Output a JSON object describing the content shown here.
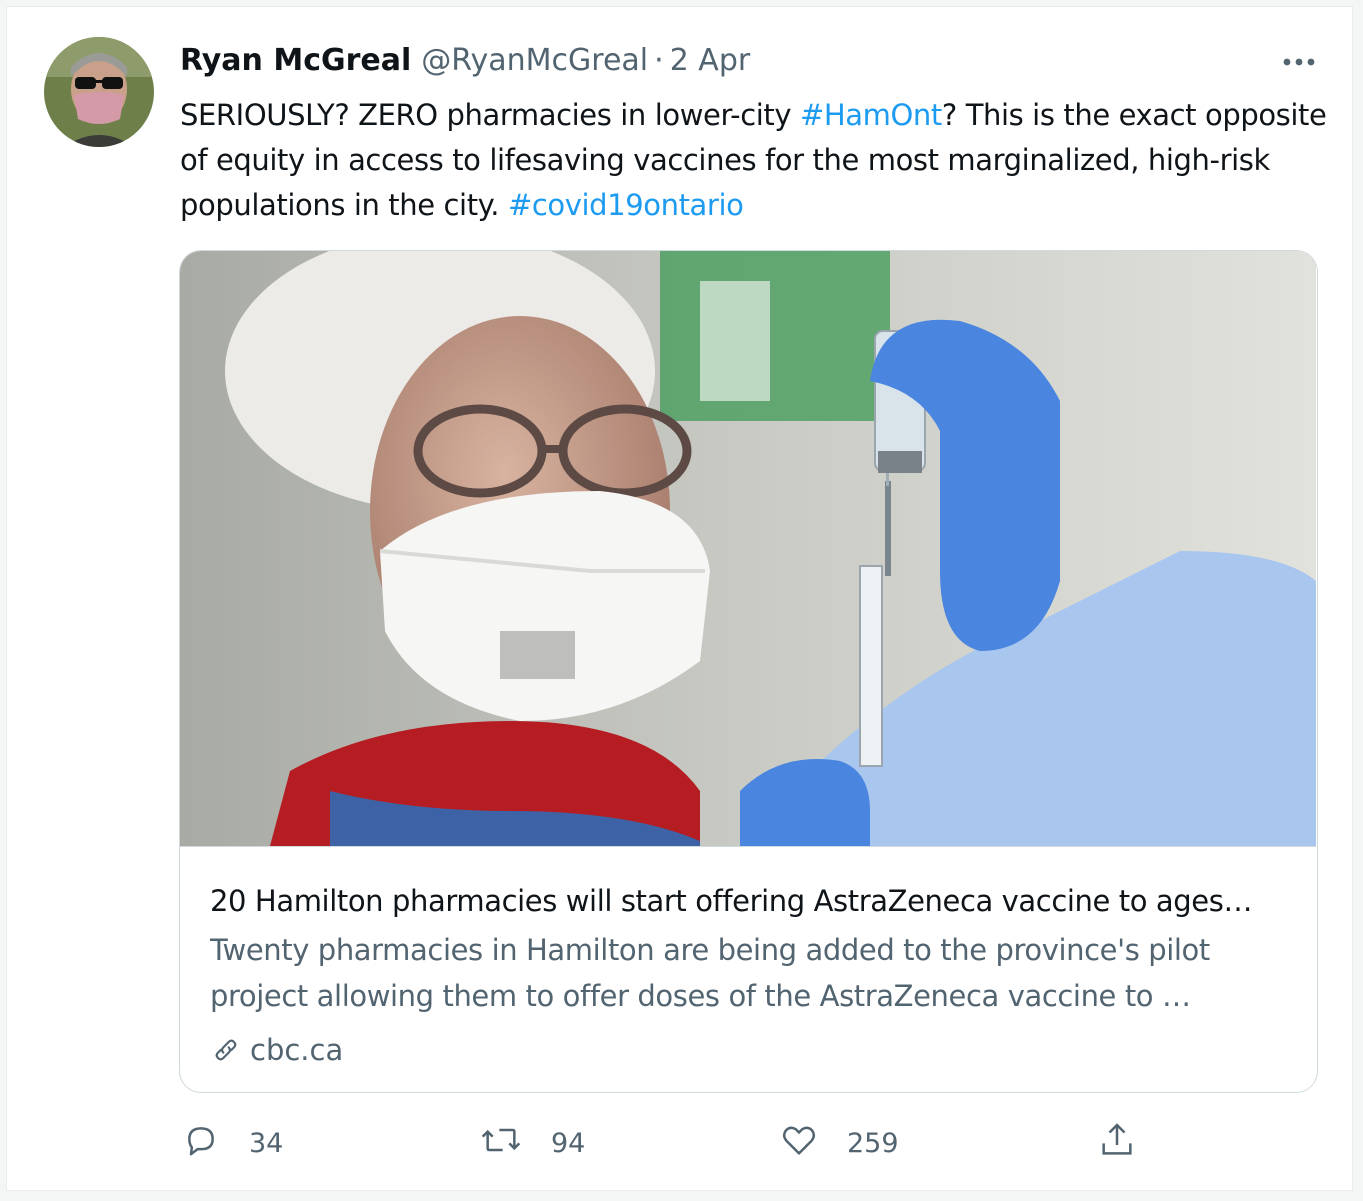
{
  "tweet": {
    "author_name": "Ryan McGreal",
    "handle": "@RyanMcGreal",
    "separator": "·",
    "date": "2 Apr",
    "text_part1": "SERIOUSLY? ZERO pharmacies in lower-city ",
    "hashtag1": "#HamOnt",
    "text_part2": "? This is the exact opposite of equity in access to lifesaving vaccines for the most marginalized, high-risk populations in the city. ",
    "hashtag2": "#covid19ontario"
  },
  "card": {
    "title": "20 Hamilton pharmacies will start offering AstraZeneca vaccine to ages…",
    "description": "Twenty pharmacies in Hamilton are being added to the province's pilot project allowing them to offer doses of the AstraZeneca vaccine to …",
    "domain": "cbc.ca"
  },
  "actions": {
    "replies": "34",
    "retweets": "94",
    "likes": "259"
  },
  "colors": {
    "link": "#1d9bf0",
    "secondary_text": "#536471",
    "primary_text": "#0f1419",
    "border": "#cfd9de"
  },
  "icons": [
    "more-icon",
    "link-icon",
    "reply-icon",
    "retweet-icon",
    "like-icon",
    "share-icon"
  ]
}
